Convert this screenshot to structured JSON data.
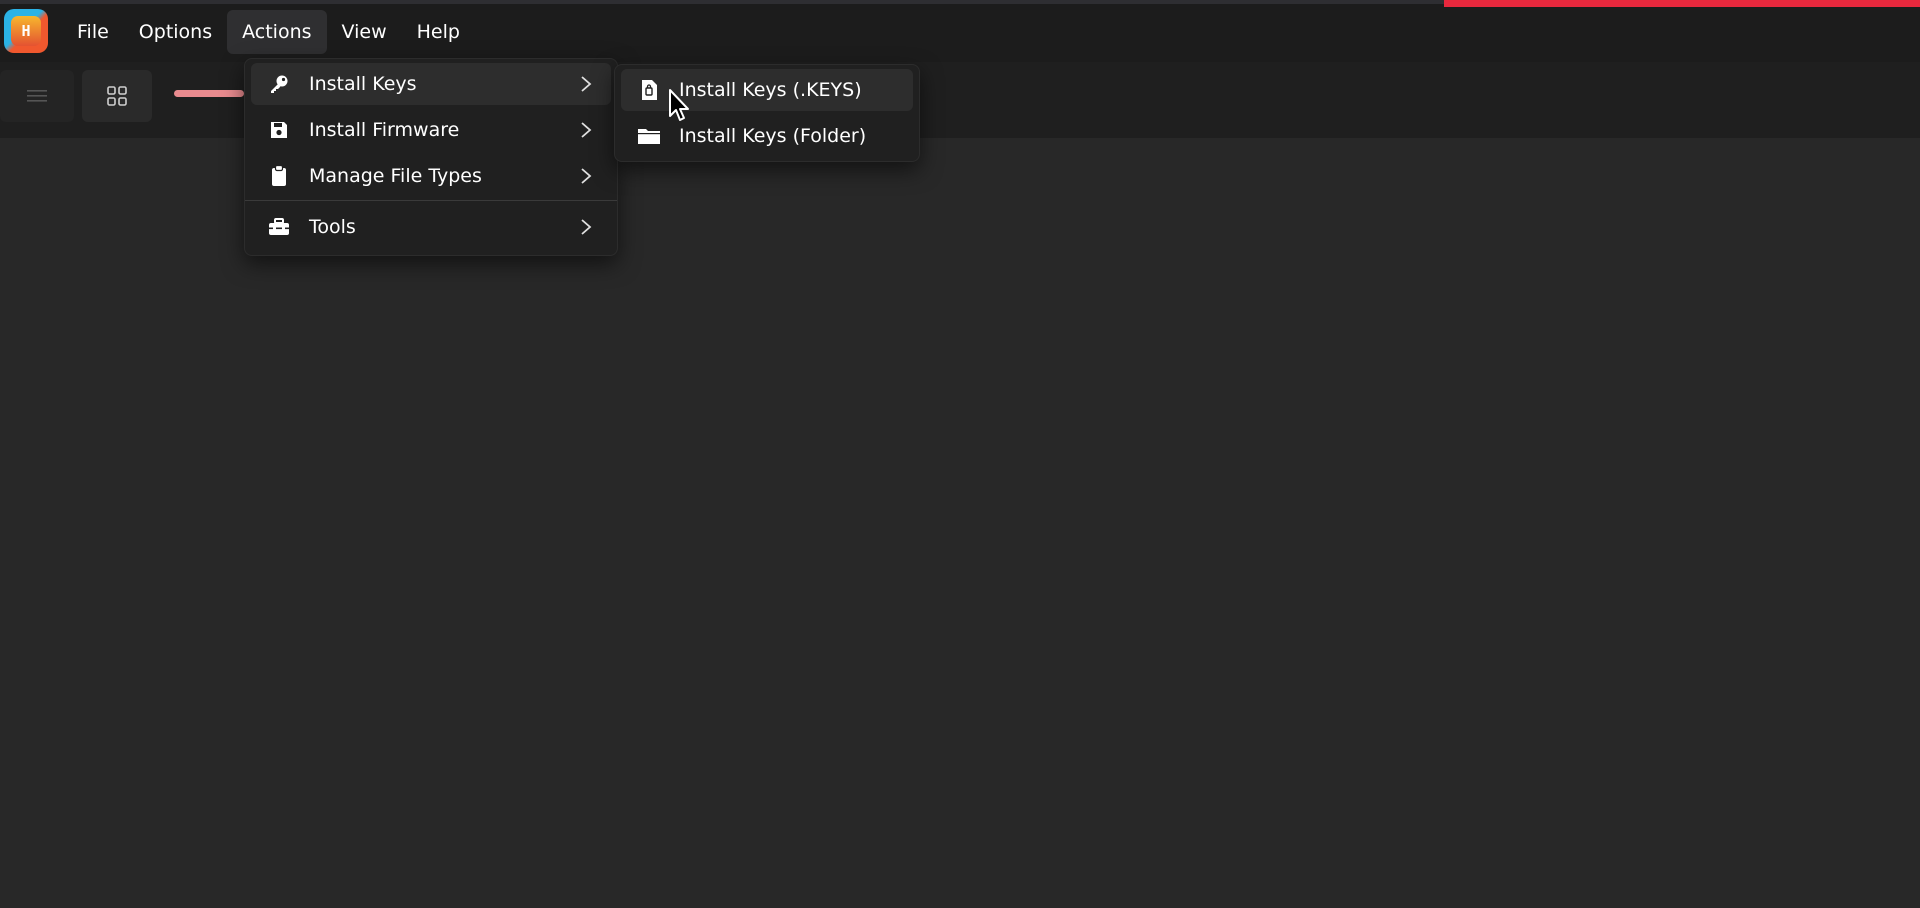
{
  "app": {
    "logo_text": "H",
    "accent_color": "#e8283d"
  },
  "menubar": {
    "items": [
      {
        "label": "File"
      },
      {
        "label": "Options"
      },
      {
        "label": "Actions",
        "active": true
      },
      {
        "label": "View"
      },
      {
        "label": "Help"
      }
    ]
  },
  "toolbar": {
    "list_view_icon": "list-icon",
    "grid_view_icon": "grid-icon"
  },
  "actions_menu": {
    "items": [
      {
        "label": "Install Keys",
        "icon": "key-icon",
        "has_submenu": true,
        "highlighted": true
      },
      {
        "label": "Install Firmware",
        "icon": "save-icon",
        "has_submenu": true
      },
      {
        "label": "Manage File Types",
        "icon": "clipboard-icon",
        "has_submenu": true
      },
      {
        "label": "Tools",
        "icon": "toolbox-icon",
        "has_submenu": true
      }
    ]
  },
  "install_keys_submenu": {
    "items": [
      {
        "label": "Install Keys (.KEYS)",
        "icon": "file-icon",
        "highlighted": true
      },
      {
        "label": "Install Keys (Folder)",
        "icon": "folder-icon"
      }
    ]
  }
}
